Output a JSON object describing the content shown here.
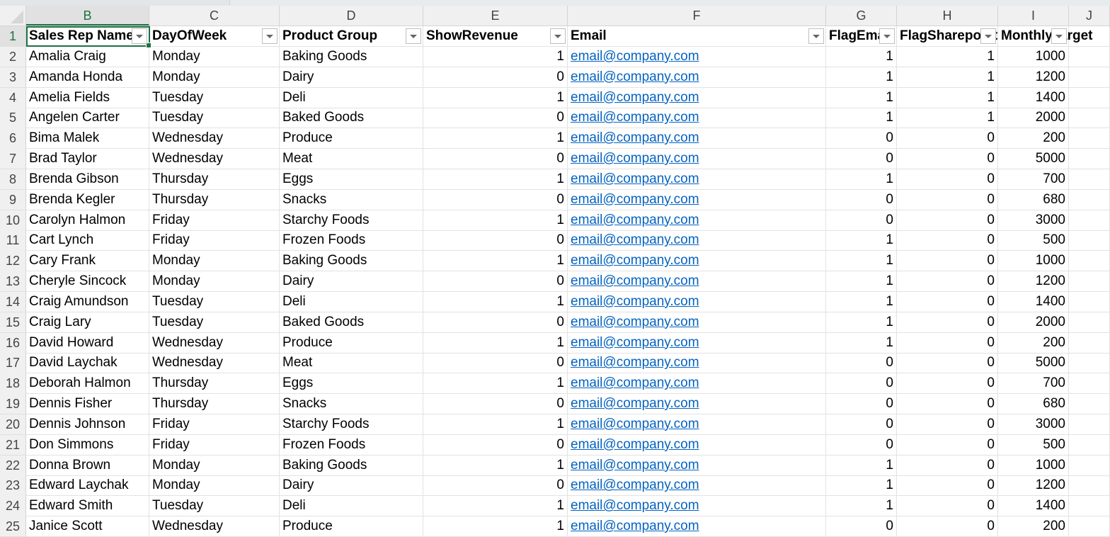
{
  "columns": [
    "B",
    "C",
    "D",
    "E",
    "F",
    "G",
    "H",
    "I",
    "J"
  ],
  "headers": [
    "Sales Rep Name",
    "DayOfWeek",
    "Product Group",
    "ShowRevenue",
    "Email",
    "FlagEmail",
    "FlagSharepoint",
    "MonthlyTarget"
  ],
  "rows": [
    [
      "Amalia Craig",
      "Monday",
      "Baking Goods",
      "1",
      "email@company.com",
      "1",
      "1",
      "1000"
    ],
    [
      "Amanda Honda",
      "Monday",
      "Dairy",
      "0",
      "email@company.com",
      "1",
      "1",
      "1200"
    ],
    [
      "Amelia Fields",
      "Tuesday",
      "Deli",
      "1",
      "email@company.com",
      "1",
      "1",
      "1400"
    ],
    [
      "Angelen Carter",
      "Tuesday",
      "Baked Goods",
      "0",
      "email@company.com",
      "1",
      "1",
      "2000"
    ],
    [
      "Bima Malek",
      "Wednesday",
      "Produce",
      "1",
      "email@company.com",
      "0",
      "0",
      "200"
    ],
    [
      "Brad Taylor",
      "Wednesday",
      "Meat",
      "0",
      "email@company.com",
      "0",
      "0",
      "5000"
    ],
    [
      "Brenda Gibson",
      "Thursday",
      "Eggs",
      "1",
      "email@company.com",
      "1",
      "0",
      "700"
    ],
    [
      "Brenda Kegler",
      "Thursday",
      "Snacks",
      "0",
      "email@company.com",
      "0",
      "0",
      "680"
    ],
    [
      "Carolyn Halmon",
      "Friday",
      "Starchy Foods",
      "1",
      "email@company.com",
      "0",
      "0",
      "3000"
    ],
    [
      "Cart Lynch",
      "Friday",
      "Frozen Foods",
      "0",
      "email@company.com",
      "1",
      "0",
      "500"
    ],
    [
      "Cary Frank",
      "Monday",
      "Baking Goods",
      "1",
      "email@company.com",
      "1",
      "0",
      "1000"
    ],
    [
      "Cheryle Sincock",
      "Monday",
      "Dairy",
      "0",
      "email@company.com",
      "1",
      "0",
      "1200"
    ],
    [
      "Craig Amundson",
      "Tuesday",
      "Deli",
      "1",
      "email@company.com",
      "1",
      "0",
      "1400"
    ],
    [
      "Craig Lary",
      "Tuesday",
      "Baked Goods",
      "0",
      "email@company.com",
      "1",
      "0",
      "2000"
    ],
    [
      "David Howard",
      "Wednesday",
      "Produce",
      "1",
      "email@company.com",
      "1",
      "0",
      "200"
    ],
    [
      "David Laychak",
      "Wednesday",
      "Meat",
      "0",
      "email@company.com",
      "0",
      "0",
      "5000"
    ],
    [
      "Deborah Halmon",
      "Thursday",
      "Eggs",
      "1",
      "email@company.com",
      "0",
      "0",
      "700"
    ],
    [
      "Dennis Fisher",
      "Thursday",
      "Snacks",
      "0",
      "email@company.com",
      "0",
      "0",
      "680"
    ],
    [
      "Dennis Johnson",
      "Friday",
      "Starchy Foods",
      "1",
      "email@company.com",
      "0",
      "0",
      "3000"
    ],
    [
      "Don Simmons",
      "Friday",
      "Frozen Foods",
      "0",
      "email@company.com",
      "0",
      "0",
      "500"
    ],
    [
      "Donna Brown",
      "Monday",
      "Baking Goods",
      "1",
      "email@company.com",
      "1",
      "0",
      "1000"
    ],
    [
      "Edward Laychak",
      "Monday",
      "Dairy",
      "0",
      "email@company.com",
      "1",
      "0",
      "1200"
    ],
    [
      "Edward Smith",
      "Tuesday",
      "Deli",
      "1",
      "email@company.com",
      "1",
      "0",
      "1400"
    ],
    [
      "Janice Scott",
      "Wednesday",
      "Produce",
      "1",
      "email@company.com",
      "0",
      "0",
      "200"
    ]
  ]
}
